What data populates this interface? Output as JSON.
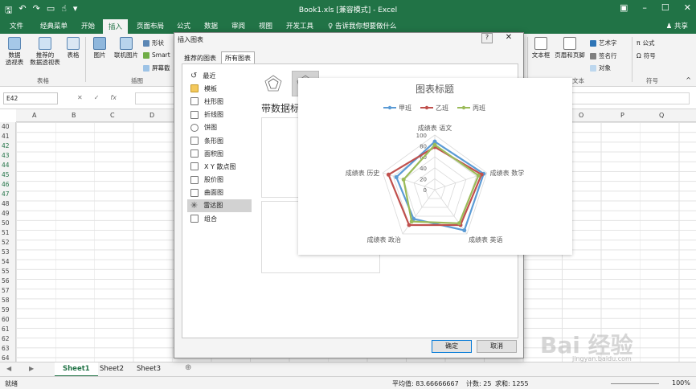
{
  "titlebar": {
    "title": "Book1.xls [兼容模式] - Excel",
    "quick_access": [
      "save-icon",
      "undo-icon",
      "redo-icon",
      "open-icon",
      "touch-icon",
      "customize-icon"
    ]
  },
  "ribbon_tabs": [
    "文件",
    "经典菜单",
    "开始",
    "插入",
    "页面布局",
    "公式",
    "数据",
    "审阅",
    "视图",
    "开发工具"
  ],
  "ribbon_active_tab": "插入",
  "tell_me": "告诉我你想要做什么",
  "share": "共享",
  "ribbon": {
    "pivot": "数据\n透视表",
    "recommended_pivot": "推荐的\n数据透视表",
    "table": "表格",
    "tables_group": "表格",
    "pictures": "图片",
    "online_pictures": "联机图片",
    "shapes": "形状",
    "smartart": "Smart",
    "screenshot": "屏幕截",
    "illustrations_group": "插图",
    "textbox": "文本框",
    "header_footer": "页眉和页脚",
    "wordart": "艺术字",
    "signature": "签名行",
    "object": "对象",
    "text_group": "文本",
    "equation": "公式",
    "symbol": "符号",
    "symbols_group": "符号"
  },
  "formula_bar": {
    "name_box": "E42",
    "cancel": "✕",
    "enter": "✓",
    "fx": "fx"
  },
  "columns": [
    "A",
    "B",
    "C",
    "D",
    "E",
    "F",
    "G",
    "H",
    "I",
    "J",
    "K",
    "L",
    "M",
    "N",
    "O",
    "P",
    "Q"
  ],
  "rows": [
    "40",
    "41",
    "42",
    "43",
    "44",
    "45",
    "46",
    "47",
    "48",
    "49",
    "50",
    "51",
    "52",
    "53",
    "54",
    "55",
    "56",
    "57",
    "58",
    "59",
    "60",
    "61",
    "62",
    "63",
    "64"
  ],
  "sheets": [
    "Sheet1",
    "Sheet2",
    "Sheet3"
  ],
  "active_sheet": "Sheet1",
  "status": {
    "ready": "就绪",
    "average": "平均值: 83.66666667",
    "count": "计数: 25",
    "sum": "求和: 1255",
    "zoom": "100%"
  },
  "dialog": {
    "title": "插入图表",
    "help": "?",
    "close": "✕",
    "tabs": [
      "推荐的图表",
      "所有图表"
    ],
    "active_tab": "所有图表",
    "categories": [
      {
        "label": "最近",
        "icon": "recent-icon"
      },
      {
        "label": "模板",
        "icon": "folder-icon"
      },
      {
        "label": "柱形图",
        "icon": "column-chart-icon"
      },
      {
        "label": "折线图",
        "icon": "line-chart-icon"
      },
      {
        "label": "饼图",
        "icon": "pie-chart-icon"
      },
      {
        "label": "条形图",
        "icon": "bar-chart-icon"
      },
      {
        "label": "面积图",
        "icon": "area-chart-icon"
      },
      {
        "label": "X Y 散点图",
        "icon": "scatter-chart-icon"
      },
      {
        "label": "股价图",
        "icon": "stock-chart-icon"
      },
      {
        "label": "曲面图",
        "icon": "surface-chart-icon"
      },
      {
        "label": "雷达图",
        "icon": "radar-chart-icon"
      },
      {
        "label": "组合",
        "icon": "combo-chart-icon"
      }
    ],
    "active_category": "雷达图",
    "subtype_title": "带数据标记",
    "ok": "确定",
    "cancel": "取消"
  },
  "chart_data": {
    "type": "radar",
    "title": "图表标题",
    "categories": [
      "成绩表 语文",
      "成绩表 数学",
      "成绩表 英语",
      "成绩表 政治",
      "成绩表 历史"
    ],
    "series": [
      {
        "name": "甲班",
        "color": "#5b9bd5",
        "values": [
          88,
          94,
          92,
          66,
          74
        ]
      },
      {
        "name": "乙班",
        "color": "#c0504d",
        "values": [
          78,
          90,
          80,
          80,
          89
        ]
      },
      {
        "name": "丙班",
        "color": "#9bbb59",
        "values": [
          82,
          84,
          76,
          72,
          60
        ]
      }
    ],
    "ticks": [
      "0",
      "20",
      "40",
      "60",
      "80",
      "100"
    ],
    "rmax": 100
  },
  "watermark": {
    "text": "Bai 经验",
    "sub": "jingyan.baidu.com"
  }
}
